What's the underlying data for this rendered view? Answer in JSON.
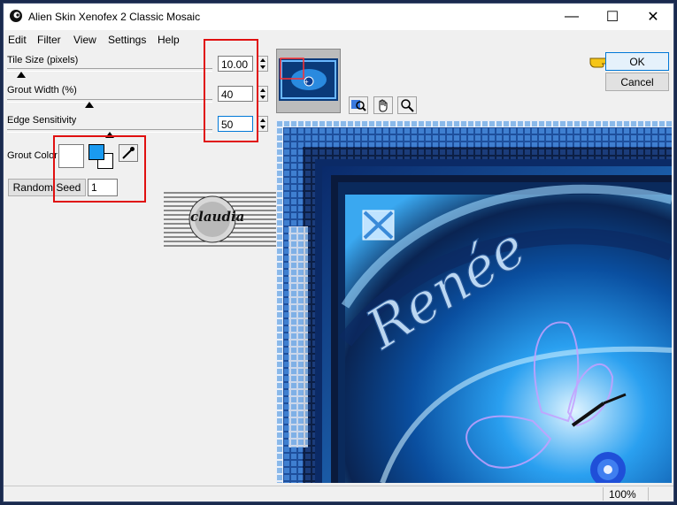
{
  "window": {
    "title": "Alien Skin Xenofex 2 Classic Mosaic",
    "minimize_glyph": "—",
    "maximize_glyph": "☐",
    "close_glyph": "✕"
  },
  "menu": {
    "items": [
      "Edit",
      "Filter",
      "View",
      "Settings",
      "Help"
    ]
  },
  "params": {
    "tile_size": {
      "label": "Tile Size (pixels)",
      "value": "10.00",
      "level": 0.07
    },
    "grout_width": {
      "label": "Grout Width (%)",
      "value": "40",
      "level": 0.4
    },
    "edge_sensitivity": {
      "label": "Edge Sensitivity",
      "value": "50",
      "level": 0.5
    }
  },
  "grout": {
    "label": "Grout Color",
    "primary_color": "#ffffff",
    "secondary_color": "#1a9af0"
  },
  "seed": {
    "button_label": "Random Seed",
    "value": "1"
  },
  "actions": {
    "ok_label": "OK",
    "cancel_label": "Cancel"
  },
  "watermark": {
    "text": "claudia"
  },
  "preview": {
    "artwork_text": "Renée"
  },
  "status": {
    "zoom": "100%"
  },
  "icons": [
    "app-icon",
    "pointing-hand-icon",
    "eyedropper-icon",
    "magnify-preview-icon",
    "hand-pan-icon",
    "zoom-icon"
  ],
  "colors": {
    "highlight_red": "#e01010",
    "accent_blue": "#1a9af0"
  }
}
